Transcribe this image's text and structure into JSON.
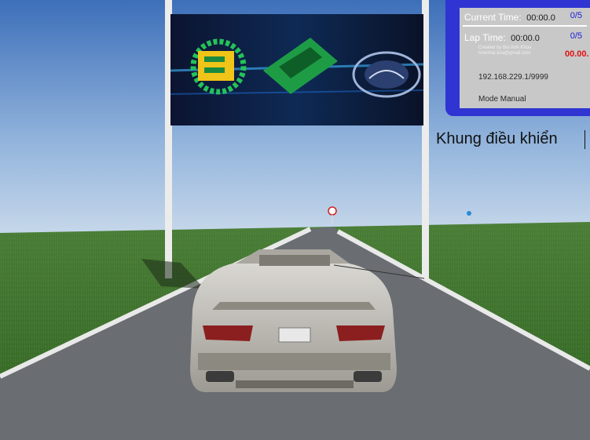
{
  "hud": {
    "current_time_label": "Current Time:",
    "current_time_value": "00:00.0",
    "current_count": "0/5",
    "lap_time_label": "Lap Time:",
    "lap_time_value": "00:00.0",
    "lap_count": "0/5",
    "credit_line1": "Created by Bui Anh Khoa",
    "credit_line2": "hoonhat.koa@gmail.com",
    "status_red": "00.00.",
    "ip_address": "192.168.229.1/9999",
    "mode": "Mode Manual"
  },
  "control_label": "Khung điều khiển",
  "colors": {
    "hud_border": "#2f34d2",
    "hud_panel": "#c8c8c8",
    "count_blue": "#1b1bd8",
    "status_red": "#e01010",
    "sky_top": "#4d7cbe",
    "grass": "#3f7a2c",
    "road": "#6a6e72"
  }
}
